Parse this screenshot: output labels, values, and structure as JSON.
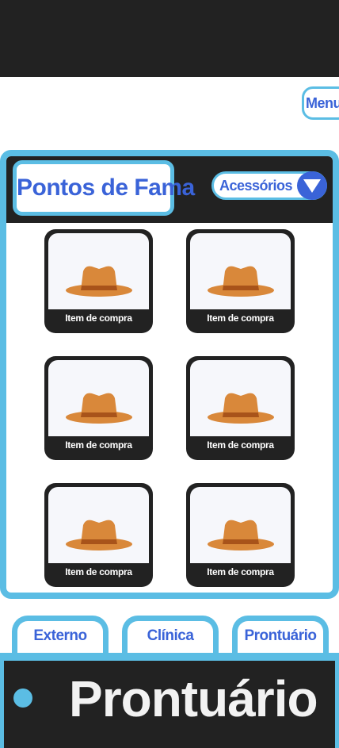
{
  "header": {
    "menu_label": "Menu"
  },
  "shop": {
    "title": "Pontos de Fama",
    "category": "Acessórios",
    "items": [
      {
        "label": "Item de compra",
        "icon": "hat-icon"
      },
      {
        "label": "Item de compra",
        "icon": "hat-icon"
      },
      {
        "label": "Item de compra",
        "icon": "hat-icon"
      },
      {
        "label": "Item de compra",
        "icon": "hat-icon"
      },
      {
        "label": "Item de compra",
        "icon": "hat-icon"
      },
      {
        "label": "Item de compra",
        "icon": "hat-icon"
      }
    ]
  },
  "tabs": [
    {
      "label": "Externo"
    },
    {
      "label": "Clínica"
    },
    {
      "label": "Prontuário"
    }
  ],
  "panel": {
    "title": "Prontuário"
  },
  "colors": {
    "accent": "#5bbde4",
    "text_blue": "#3a63d8",
    "dark": "#222222",
    "hat": "#d9883a",
    "hat_band": "#a8531a"
  }
}
